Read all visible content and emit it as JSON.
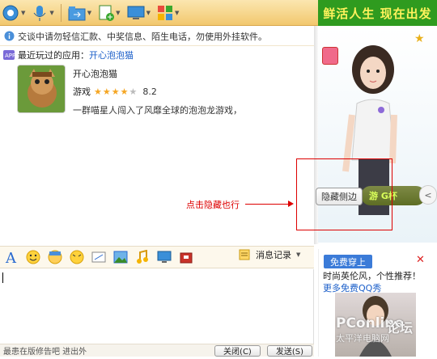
{
  "warning": "交谈中请勿轻信汇款、中奖信息、陌生电话，勿使用外挂软件。",
  "recent": {
    "label": "最近玩过的应用：",
    "link": "开心泡泡猫"
  },
  "app": {
    "name": "开心泡泡猫",
    "category": "游戏",
    "rating": "8.2",
    "stars_filled": 4,
    "stars_total": 5,
    "desc": "一群喵星人闯入了风靡全球的泡泡龙游戏，"
  },
  "annotation": {
    "tip": "点击隐藏也行",
    "hide_button": "隐藏侧边"
  },
  "toolbar": {
    "msg_record": "消息记录"
  },
  "bottom": {
    "tip": "最患在版修告吧   进出外",
    "close_label": "关闭(C)",
    "send_label": "发送(S)"
  },
  "right_panel": {
    "banner": "鲜活人生 现在出发",
    "strip_text": "游 G杯",
    "circle": "<"
  },
  "ad": {
    "badge": "免费穿上",
    "line1": "时尚英伦风，个性推荐！",
    "line2": "更多免费QQ秀",
    "close": "✕"
  },
  "watermark": {
    "brand": "PConline",
    "cn": "论坛",
    "sub": "太平洋电脑网"
  },
  "colors": {
    "toolbar": "#f2c86e",
    "banner_bg": "#2f9b1f",
    "banner_text": "#fff25c",
    "link": "#1a5ec9",
    "annotation": "#dd0000"
  }
}
